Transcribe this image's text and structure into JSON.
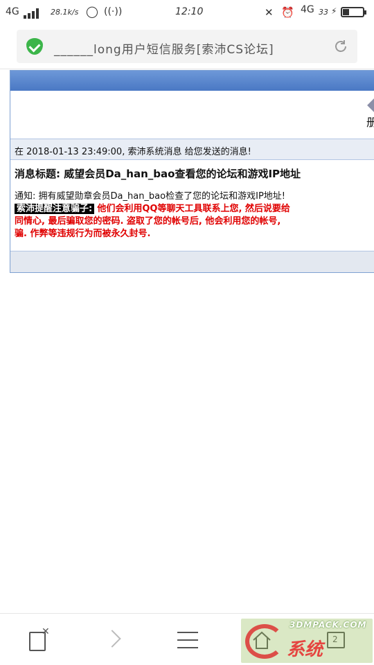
{
  "status_bar": {
    "network_left": "4G",
    "speed": "28.1k/s",
    "time": "12:10",
    "network_right": "4G",
    "battery_percent": "33",
    "battery_level": 0.33
  },
  "address_bar": {
    "page_title": "______long用户短信服务[索沛CS论坛]",
    "secure_icon": "shield-check-icon",
    "reload_icon": "reload-icon"
  },
  "message": {
    "date_line": "在 2018-01-13 23:49:00, 索沛系统消息 给您发送的消息!",
    "subject_line": "消息标题: 威望会员Da_han_bao查看您的论坛和游戏IP地址",
    "notice_line": "通知: 拥有威望勋章会员Da_han_bao检查了您的论坛和游戏IP地址!",
    "warning_label": "索沛提醒注意骗子:",
    "warning_line_1": "他们会利用QQ等聊天工具联系上您, 然后说要给",
    "warning_line_2": "同情心, 最后骗取您的密码. 盗取了您的帐号后, 他会利用您的帐号,",
    "warning_line_3": "骗. 作弊等违规行为而被永久封号.",
    "side_icon_text": "册"
  },
  "bottom_nav": {
    "tabs_count": "2"
  },
  "watermark": {
    "top": "3DMPACK.COM",
    "bottom": "系统"
  },
  "colors": {
    "panel_header": "#5a86cc",
    "warning_red": "#e00000",
    "secure_green": "#3cb54a"
  }
}
